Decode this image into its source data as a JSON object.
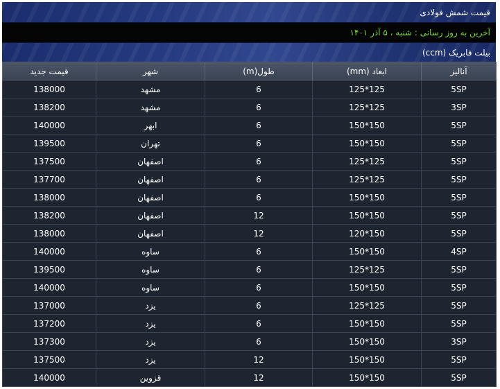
{
  "header": {
    "title": "قیمت شمش فولادی"
  },
  "update": {
    "text": "آخرین به روز رسانی : شنبه ، ۵ آذر ۱۴۰۱"
  },
  "section": {
    "title": "بیلت فابریک (ccm)"
  },
  "table": {
    "headers": [
      "آنالیز",
      "ابعاد (mm)",
      "طول(m)",
      "شهر",
      "قیمت جدید"
    ],
    "rows": [
      [
        "5SP",
        "125*125",
        "6",
        "مشهد",
        "138000"
      ],
      [
        "3SP",
        "125*125",
        "6",
        "مشهد",
        "138200"
      ],
      [
        "5SP",
        "150*150",
        "6",
        "ابهر",
        "140000"
      ],
      [
        "5SP",
        "150*150",
        "6",
        "تهران",
        "139500"
      ],
      [
        "5SP",
        "125*125",
        "6",
        "اصفهان",
        "137500"
      ],
      [
        "5SP",
        "125*125",
        "6",
        "اصفهان",
        "137700"
      ],
      [
        "5SP",
        "150*150",
        "6",
        "اصفهان",
        "138000"
      ],
      [
        "5SP",
        "150*150",
        "12",
        "اصفهان",
        "138200"
      ],
      [
        "5SP",
        "120*150",
        "12",
        "اصفهان",
        "138000"
      ],
      [
        "4SP",
        "150*150",
        "6",
        "ساوه",
        "140000"
      ],
      [
        "5SP",
        "125*125",
        "6",
        "ساوه",
        "139500"
      ],
      [
        "5SP",
        "150*150",
        "6",
        "ساوه",
        "140000"
      ],
      [
        "5SP",
        "125*125",
        "6",
        "یزد",
        "137000"
      ],
      [
        "5SP",
        "150*150",
        "6",
        "یزد",
        "137200"
      ],
      [
        "3SP",
        "150*150",
        "6",
        "یزد",
        "137300"
      ],
      [
        "5SP",
        "150*150",
        "12",
        "یزد",
        "137500"
      ],
      [
        "5SP",
        "150*150",
        "12",
        "قزوین",
        "140000"
      ]
    ]
  }
}
